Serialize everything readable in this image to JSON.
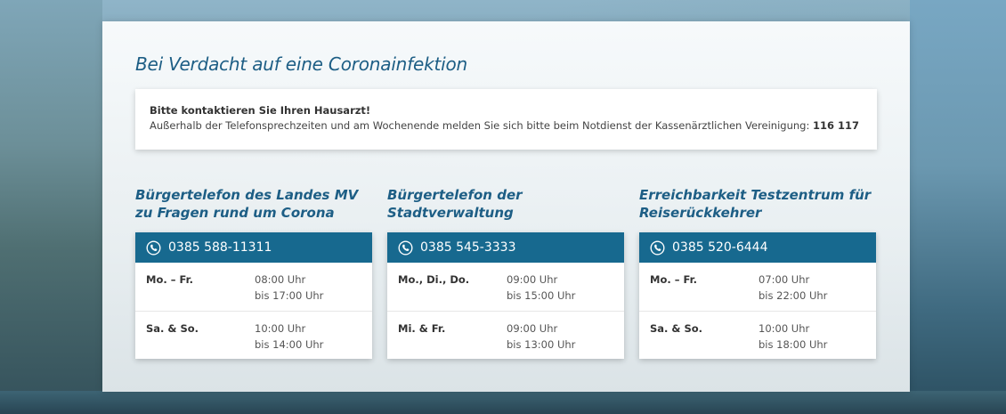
{
  "headline": "Bei Verdacht auf eine Coronainfektion",
  "notice": {
    "title": "Bitte kontaktieren Sie Ihren Hausarzt!",
    "text": "Außerhalb der Telefonsprechzeiten und am Wochenende melden Sie sich bitte beim Notdienst der Kassenärztlichen Vereinigung: ",
    "number": "116 117"
  },
  "columns": [
    {
      "title_line1": "Bürgertelefon des Landes MV",
      "title_line2": "zu Fragen rund um Corona",
      "phone": "0385 588-11311",
      "rows": [
        {
          "day": "Mo. – Fr.",
          "from": "08:00 Uhr",
          "to": "bis 17:00 Uhr"
        },
        {
          "day": "Sa. & So.",
          "from": "10:00 Uhr",
          "to": "bis 14:00 Uhr"
        }
      ]
    },
    {
      "title_line1": "Bürgertelefon der Stadtverwaltung",
      "title_line2": "",
      "phone": "0385 545-3333",
      "rows": [
        {
          "day": "Mo., Di., Do.",
          "from": "09:00 Uhr",
          "to": "bis 15:00 Uhr"
        },
        {
          "day": "Mi. & Fr.",
          "from": "09:00 Uhr",
          "to": "bis 13:00 Uhr"
        }
      ]
    },
    {
      "title_line1": "Erreichbarkeit Testzentrum für",
      "title_line2": "Reiserückkehrer",
      "phone": "0385 520-6444",
      "rows": [
        {
          "day": "Mo. – Fr.",
          "from": "07:00 Uhr",
          "to": "bis 22:00 Uhr"
        },
        {
          "day": "Sa. & So.",
          "from": "10:00 Uhr",
          "to": "bis 18:00 Uhr"
        }
      ]
    }
  ],
  "colors": {
    "accent": "#1d5e85",
    "phone_bar": "#17698f"
  },
  "icons": {
    "phone": "phone-icon"
  }
}
